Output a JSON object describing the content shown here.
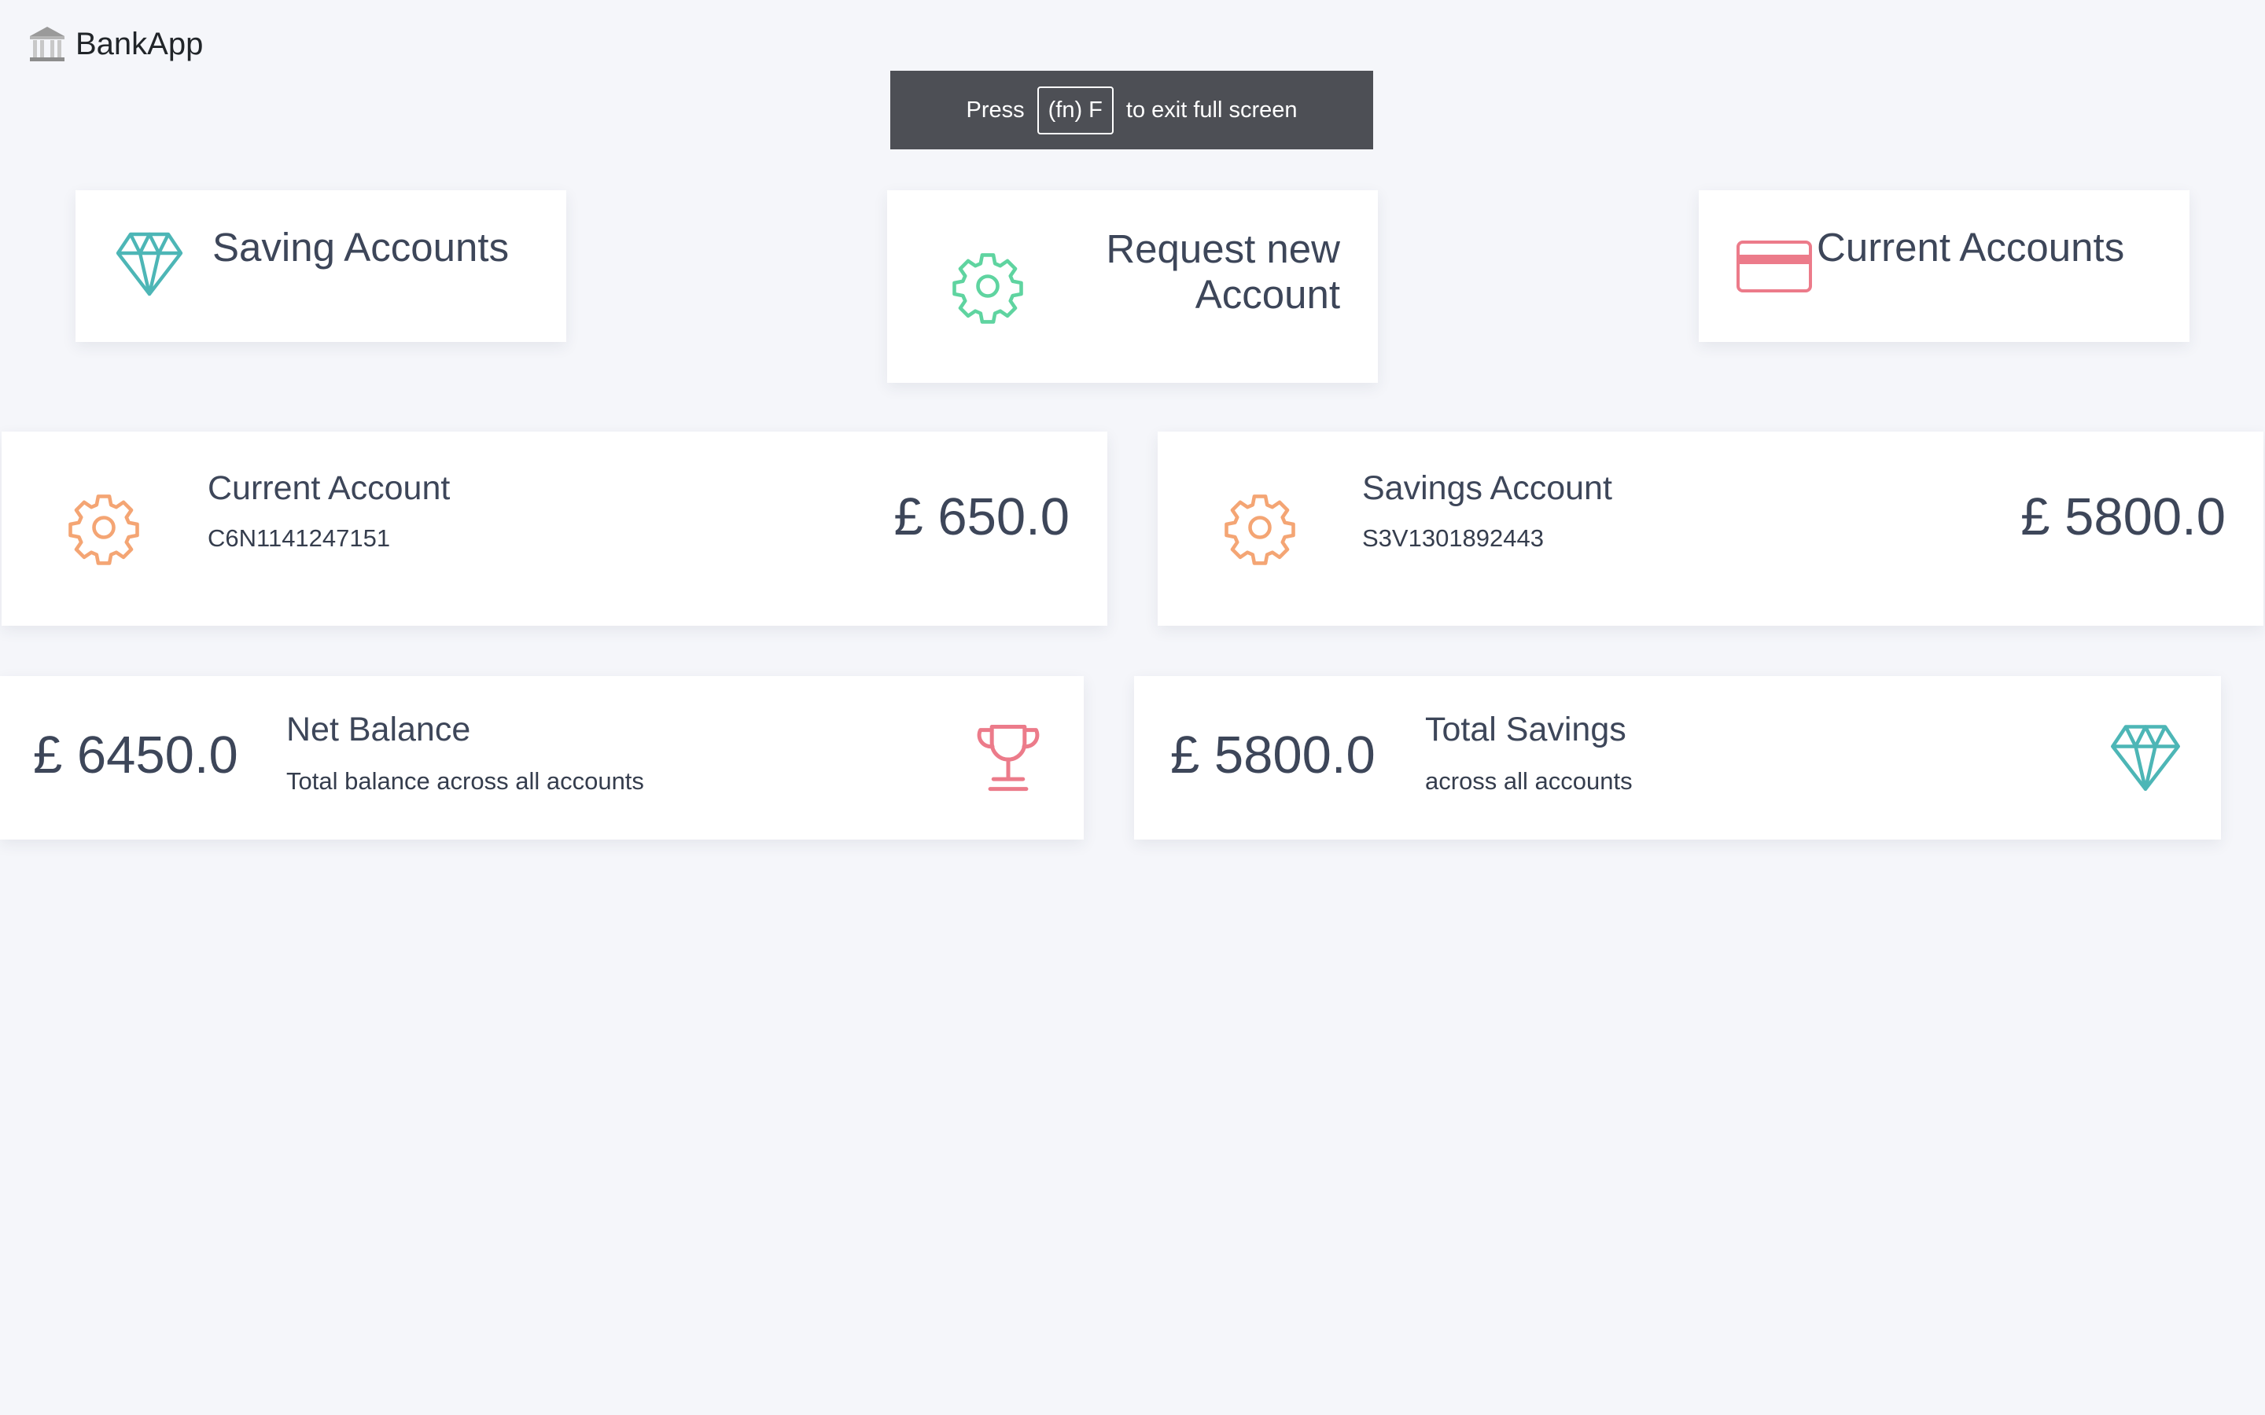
{
  "app": {
    "name": "BankApp",
    "logo_icon": "bank-building-icon"
  },
  "fullscreen_notice": {
    "prefix": "Press",
    "key": "(fn) F",
    "suffix": "to exit full screen"
  },
  "nav_cards": {
    "saving": {
      "title": "Saving Accounts",
      "icon": "diamond-icon",
      "color": "#4db6b6"
    },
    "request": {
      "title_line1": "Request new",
      "title_line2": "Account",
      "icon": "gear-icon",
      "color": "#5fd4a0"
    },
    "current": {
      "title": "Current Accounts",
      "icon": "credit-card-icon",
      "color": "#ec7b8a"
    }
  },
  "accounts": [
    {
      "name": "Current Account",
      "number": "C6N1141247151",
      "balance": "£ 650.0",
      "icon": "gear-icon",
      "color": "#f4a574"
    },
    {
      "name": "Savings Account",
      "number": "S3V1301892443",
      "balance": "£ 5800.0",
      "icon": "gear-icon",
      "color": "#f4a574"
    }
  ],
  "summaries": {
    "net": {
      "value": "£ 6450.0",
      "title": "Net Balance",
      "subtitle": "Total balance across all accounts",
      "icon": "trophy-icon",
      "color": "#ec7b8a"
    },
    "savings": {
      "value": "£ 5800.0",
      "title": "Total Savings",
      "subtitle": "across all accounts",
      "icon": "diamond-icon",
      "color": "#4db6b6"
    }
  }
}
